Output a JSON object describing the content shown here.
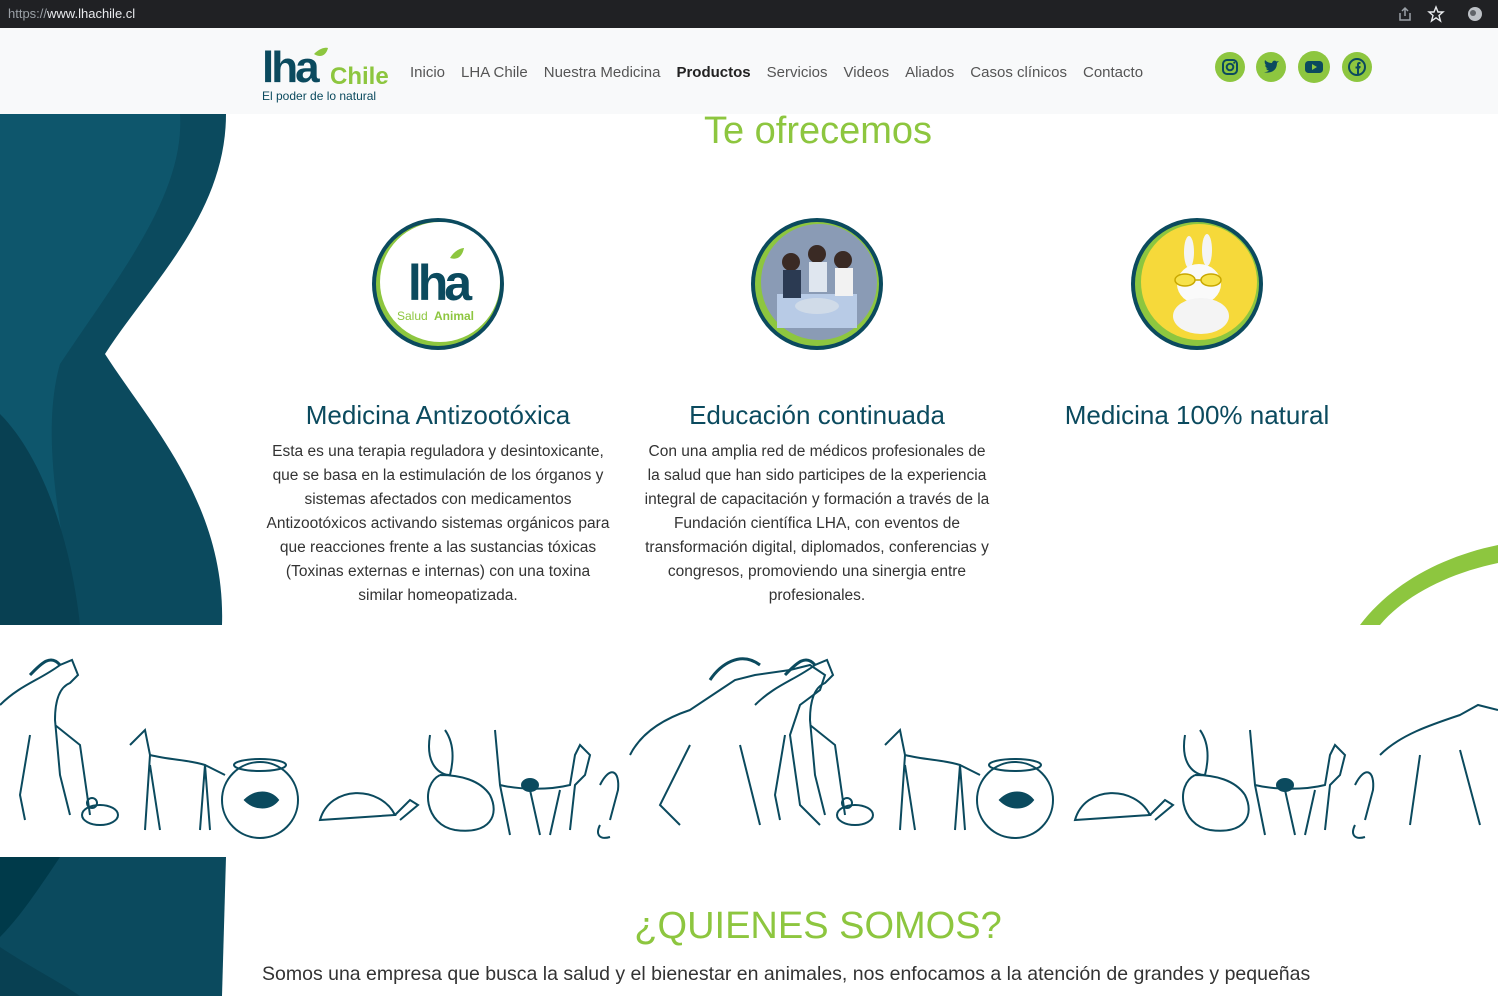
{
  "browser": {
    "url_scheme": "https://",
    "url_host": "www.lhachile.cl"
  },
  "header": {
    "logo": {
      "brand": "lha",
      "brand2": "Chile",
      "tagline": "El poder de lo natural"
    },
    "nav": [
      "Inicio",
      "LHA Chile",
      "Nuestra Medicina",
      "Productos",
      "Servicios",
      "Videos",
      "Aliados",
      "Casos clínicos",
      "Contacto"
    ],
    "active_nav": "Productos",
    "social_icons": [
      "instagram-icon",
      "twitter-icon",
      "youtube-icon",
      "facebook-icon"
    ]
  },
  "offer": {
    "title": "Te ofrecemos",
    "features": [
      {
        "image_text_main": "lha",
        "image_text_sub1": "Salud",
        "image_text_sub2": "Animal",
        "heading": "Medicina Antizootóxica",
        "text": "Esta es una terapia reguladora y desintoxicante, que se basa en la estimulación de los órganos y sistemas afectados con medicamentos Antizootóxicos activando sistemas orgánicos para que reacciones frente a las sustancias tóxicas (Toxinas externas e internas) con una toxina similar homeopatizada."
      },
      {
        "heading": "Educación continuada",
        "text": "Con una amplia red de médicos profesionales de la salud que han sido participes de la experiencia integral de capacitación y formación a través de la Fundación científica LHA, con eventos de transformación digital, diplomados, conferencias y congresos, promoviendo una sinergia entre profesionales."
      },
      {
        "heading": "Medicina 100% natural",
        "text": ""
      }
    ]
  },
  "about": {
    "title": "¿QUIENES SOMOS?",
    "text": "Somos una empresa que busca la salud y el bienestar en animales, nos enfocamos a la atención de grandes y pequeñas"
  },
  "colors": {
    "green": "#8dc63f",
    "teal": "#0b4a5e",
    "dark_teal": "#003a4a"
  }
}
